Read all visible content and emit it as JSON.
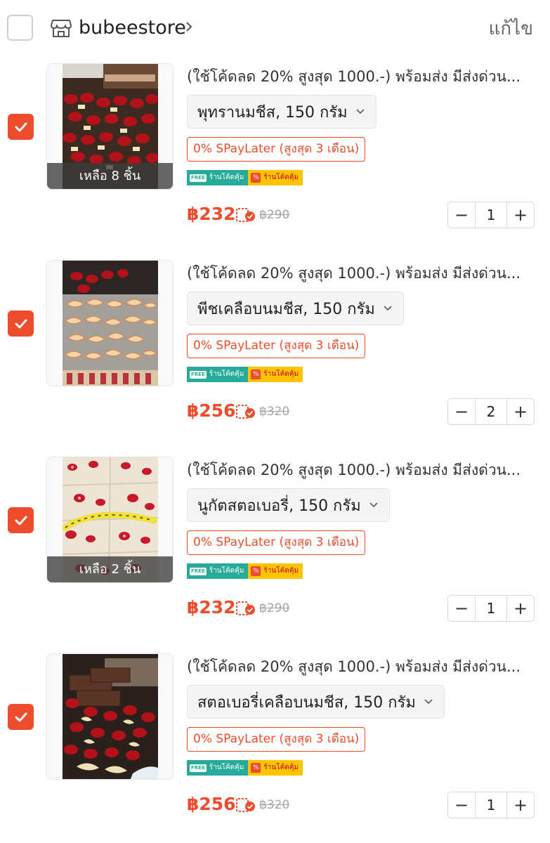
{
  "header": {
    "store_name": "bubeestore",
    "edit_label": "แก้ไข"
  },
  "colors": {
    "accent": "#ee4d2d",
    "free_badge": "#26aa99",
    "code_badge": "#ffc400"
  },
  "badges": {
    "free_tag": "FREE",
    "free_label": "ร้านโค้ดคุ้ม",
    "code_tag": "%",
    "code_label": "ร้านโค้ดคุ้ม"
  },
  "items": [
    {
      "title": "(ใช้โค้ดลด 20% สูงสุด 1000.-) พร้อมส่ง มีส่งด่วน...",
      "variant": "พุทรานมชีส, 150 กรัม",
      "spay": "0% SPayLater (สูงสุด 3 เดือน)",
      "stock": "เหลือ 8 ชิ้น",
      "price": "฿232",
      "old_price": "฿290",
      "qty": "1",
      "checked": true,
      "image": "jujube-cheese"
    },
    {
      "title": "(ใช้โค้ดลด 20% สูงสุด 1000.-) พร้อมส่ง มีส่งด่วน...",
      "variant": "พีชเคลือบนมชีส, 150 กรัม",
      "spay": "0% SPayLater (สูงสุด 3 เดือน)",
      "stock": "",
      "price": "฿256",
      "old_price": "฿320",
      "qty": "2",
      "checked": true,
      "image": "peach-cheese"
    },
    {
      "title": "(ใช้โค้ดลด 20% สูงสุด 1000.-) พร้อมส่ง มีส่งด่วน...",
      "variant": "นูกัตสตอเบอรี่, 150 กรัม",
      "spay": "0% SPayLater (สูงสุด 3 เดือน)",
      "stock": "เหลือ 2 ชิ้น",
      "price": "฿232",
      "old_price": "฿290",
      "qty": "1",
      "checked": true,
      "image": "strawberry-nougat"
    },
    {
      "title": "(ใช้โค้ดลด 20% สูงสุด 1000.-) พร้อมส่ง มีส่งด่วน...",
      "variant": "สตอเบอรี่เคลือบนมชีส, 150 กรัม",
      "spay": "0% SPayLater (สูงสุด 3 เดือน)",
      "stock": "",
      "price": "฿256",
      "old_price": "฿320",
      "qty": "1",
      "checked": true,
      "image": "strawberry-cheese"
    }
  ]
}
